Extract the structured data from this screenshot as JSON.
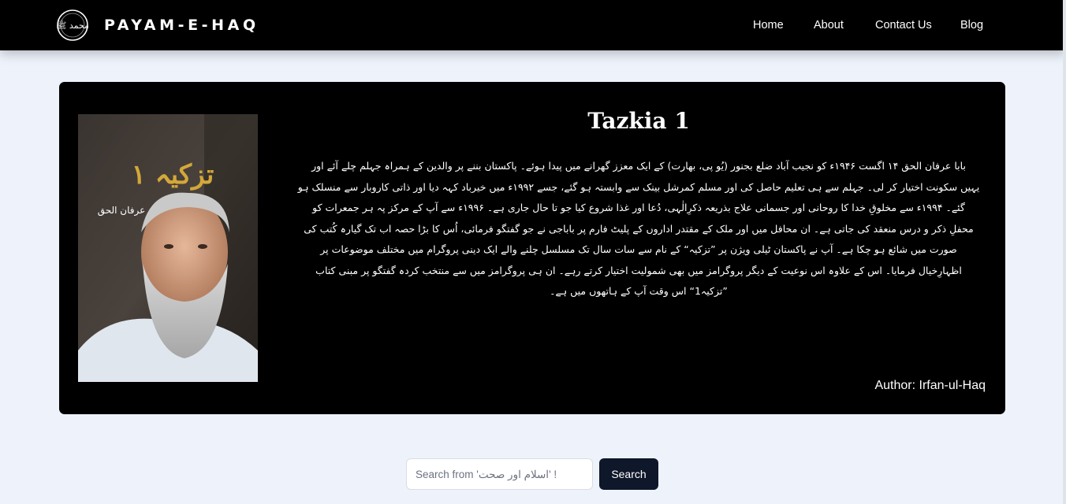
{
  "navbar": {
    "logo_text": "محمد ﷺ",
    "brand": "PAYAM-E-HAQ",
    "links": [
      "Home",
      "About",
      "Contact Us",
      "Blog"
    ]
  },
  "book": {
    "title": "Tazkia 1",
    "cover": {
      "title_text": "تزکیہ ۱",
      "author_text": "عرفان الحق"
    },
    "description_lines": [
      "بابا عرفان الحق ۱۴ اگست ۱۹۴۶ء کو نجیب آباد ضلع بجنور (یُو پی، بھارت) کے ایک معزز گھرانے میں پیدا ہوئے۔ پاکستان بننے پر والدین کے ہمراہ جہلم چلے آئے اور",
      "یہیں سکونت اختیار کر لی۔ جہلم سے ہی تعلیم حاصل کی اور مسلم کمرشل بینک سے وابستہ ہو گئے، جسے ۱۹۹۲ء میں خیرباد کہہ دیا اور ذاتی کاروبار سے منسلک ہو",
      "گئے۔ ۱۹۹۴ء سے مخلوقِ خدا کا روحانی اور جسمانی علاج بذریعہ ذکرِالٰہی، دُعا اور غذا شروع کیا جو تا حال جاری ہے۔ ۱۹۹۶ء سے آپ کے مرکز پہ ہر جمعرات کو",
      "محفلِ ذکر و درس منعقد کی جاتی ہے۔ ان محافل میں اور ملک کے مقتدر اداروں کے پلیٹ فارم پر باباجی نے جو گفتگو فرمائی، اُس کا بڑا حصہ اب تک گیارہ کُتب کی",
      "صورت میں شائع ہو چکا ہے۔ آپ نے پاکستان ٹیلی ویژن پر ”تزکیہ“ کے نام سے سات سال تک مسلسل چلنے والے ایک دینی پروگرام میں مختلف موضوعات پر",
      "اظہارِخیال فرمایا۔ اس کے علاوہ اس نوعیت کے دیگر پروگرامز میں بھی شمولیت اختیار کرتے رہے۔ ان ہی پروگرامز میں سے منتخب کردہ گفتگو پر مبنی کتاب",
      "”تزکیہ1“ اس وقت آپ کے ہاتھوں میں ہے۔"
    ],
    "author": "Author: Irfan-ul-Haq"
  },
  "search": {
    "placeholder": "Search from 'اسلام اور صحت' !",
    "button_label": "Search"
  }
}
